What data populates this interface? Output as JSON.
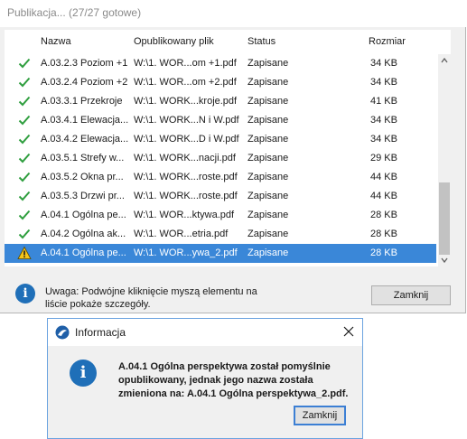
{
  "window": {
    "title": "Publikacja... (27/27 gotowe)"
  },
  "table": {
    "columns": [
      "Nazwa",
      "Opublikowany plik",
      "Status",
      "Rozmiar"
    ],
    "rows": [
      {
        "name": "A.03.2.3 Poziom +1",
        "file": "W:\\1. WOR...om +1.pdf",
        "status": "Zapisane",
        "size": "34 KB",
        "icon": "check-icon"
      },
      {
        "name": "A.03.2.4 Poziom +2",
        "file": "W:\\1. WOR...om +2.pdf",
        "status": "Zapisane",
        "size": "34 KB",
        "icon": "check-icon"
      },
      {
        "name": "A.03.3.1 Przekroje",
        "file": "W:\\1. WORK...kroje.pdf",
        "status": "Zapisane",
        "size": "41 KB",
        "icon": "check-icon"
      },
      {
        "name": "A.03.4.1 Elewacja...",
        "file": "W:\\1. WORK...N i W.pdf",
        "status": "Zapisane",
        "size": "34 KB",
        "icon": "check-icon"
      },
      {
        "name": "A.03.4.2 Elewacja...",
        "file": "W:\\1. WORK...D i W.pdf",
        "status": "Zapisane",
        "size": "34 KB",
        "icon": "check-icon"
      },
      {
        "name": "A.03.5.1 Strefy w...",
        "file": "W:\\1. WORK...nacji.pdf",
        "status": "Zapisane",
        "size": "29 KB",
        "icon": "check-icon"
      },
      {
        "name": "A.03.5.2 Okna pr...",
        "file": "W:\\1. WORK...roste.pdf",
        "status": "Zapisane",
        "size": "44 KB",
        "icon": "check-icon"
      },
      {
        "name": "A.03.5.3 Drzwi pr...",
        "file": "W:\\1. WORK...roste.pdf",
        "status": "Zapisane",
        "size": "44 KB",
        "icon": "check-icon"
      },
      {
        "name": "A.04.1 Ogólna pe...",
        "file": "W:\\1. WOR...ktywa.pdf",
        "status": "Zapisane",
        "size": "28 KB",
        "icon": "check-icon"
      },
      {
        "name": "A.04.2 Ogólna ak...",
        "file": "W:\\1. WOR...etria.pdf",
        "status": "Zapisane",
        "size": "28 KB",
        "icon": "check-icon"
      },
      {
        "name": "A.04.1 Ogólna pe...",
        "file": "W:\\1. WOR...ywa_2.pdf",
        "status": "Zapisane",
        "size": "28 KB",
        "icon": "warning-icon",
        "selected": true
      }
    ]
  },
  "footer": {
    "note": "Uwaga: Podwójne kliknięcie myszą elementu na liście pokaże szczegóły.",
    "close_label": "Zamknij"
  },
  "dialog": {
    "title": "Informacja",
    "message": "A.04.1 Ogólna perspektywa został pomyślnie opublikowany, jednak jego nazwa została zmieniona na: A.04.1 Ogólna perspektywa_2.pdf.",
    "close_label": "Zamknij"
  },
  "colors": {
    "selection": "#3a87d8",
    "check": "#2e9e3e",
    "warning": "#f5c518",
    "info": "#1f6fb8"
  }
}
